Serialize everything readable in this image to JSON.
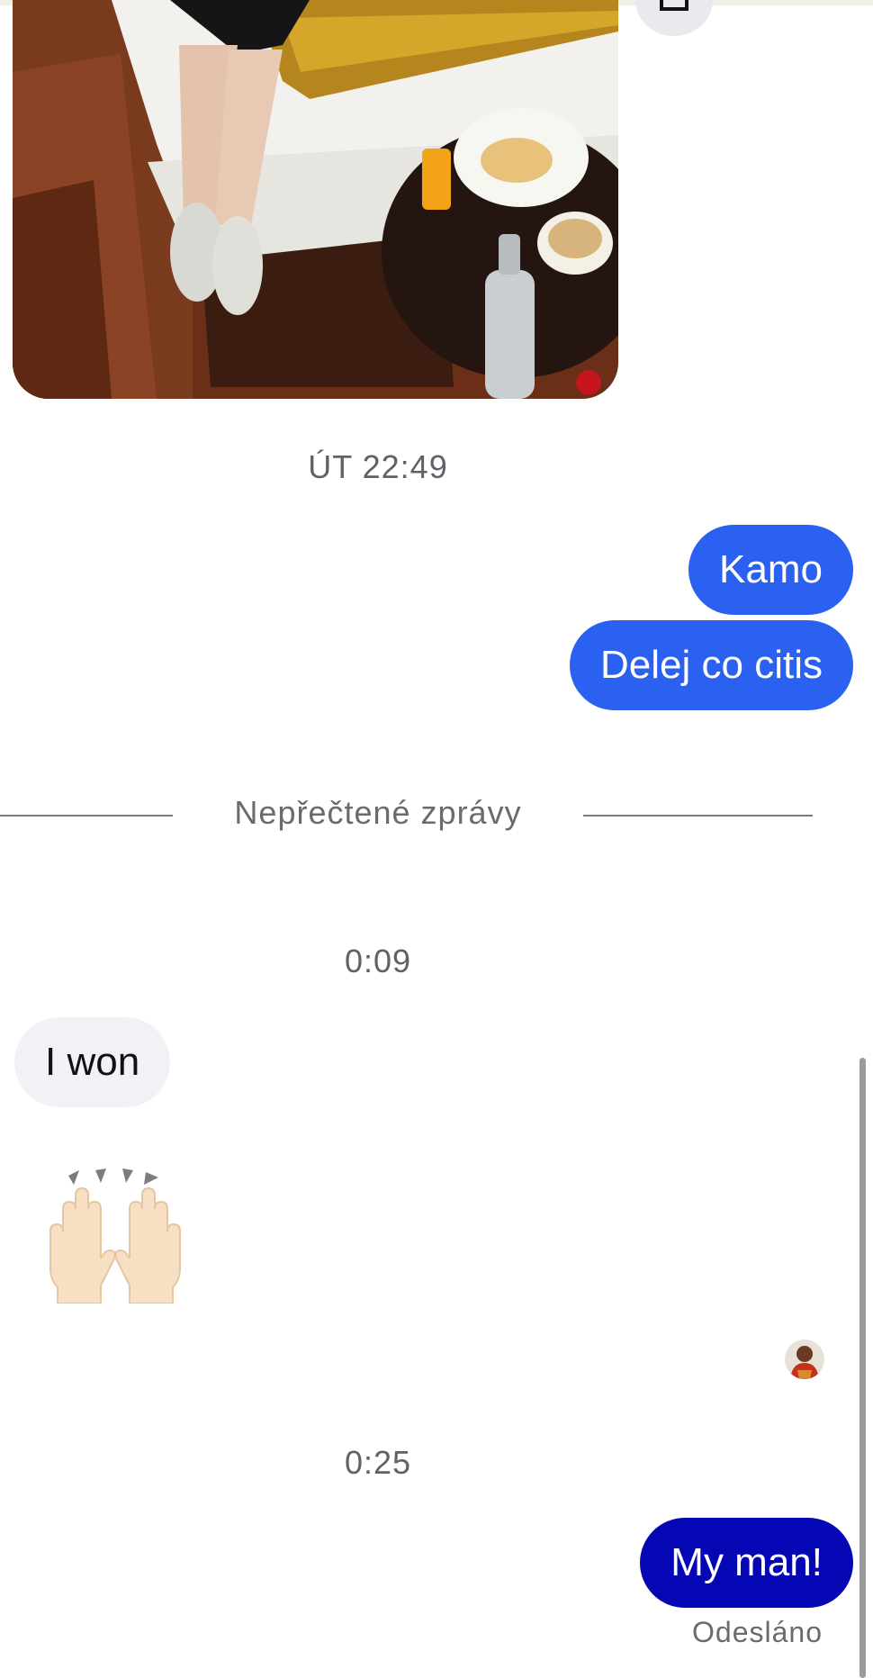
{
  "conversation": {
    "photo_message": {
      "icon": "shared-photo",
      "share_icon": "share-icon"
    },
    "groups": [
      {
        "timestamp": "ÚT 22:49"
      },
      {
        "timestamp": "0:09"
      },
      {
        "timestamp": "0:25"
      }
    ],
    "messages": [
      {
        "text": "Kamo",
        "direction": "outgoing"
      },
      {
        "text": "Delej co citis",
        "direction": "outgoing"
      },
      {
        "text": "I won",
        "direction": "incoming"
      },
      {
        "text": "My man!",
        "direction": "outgoing"
      }
    ],
    "unread_divider": "Nepřečtené zprávy",
    "reaction_emoji": "raising-hands-emoji",
    "read_receipt": "avatar",
    "delivery_status": "Odesláno"
  },
  "colors": {
    "outgoing_bubble": "#2b61f0",
    "outgoing_bubble_latest": "#0407b3",
    "incoming_bubble": "#f1f2f6",
    "meta_text": "#5f6368"
  }
}
